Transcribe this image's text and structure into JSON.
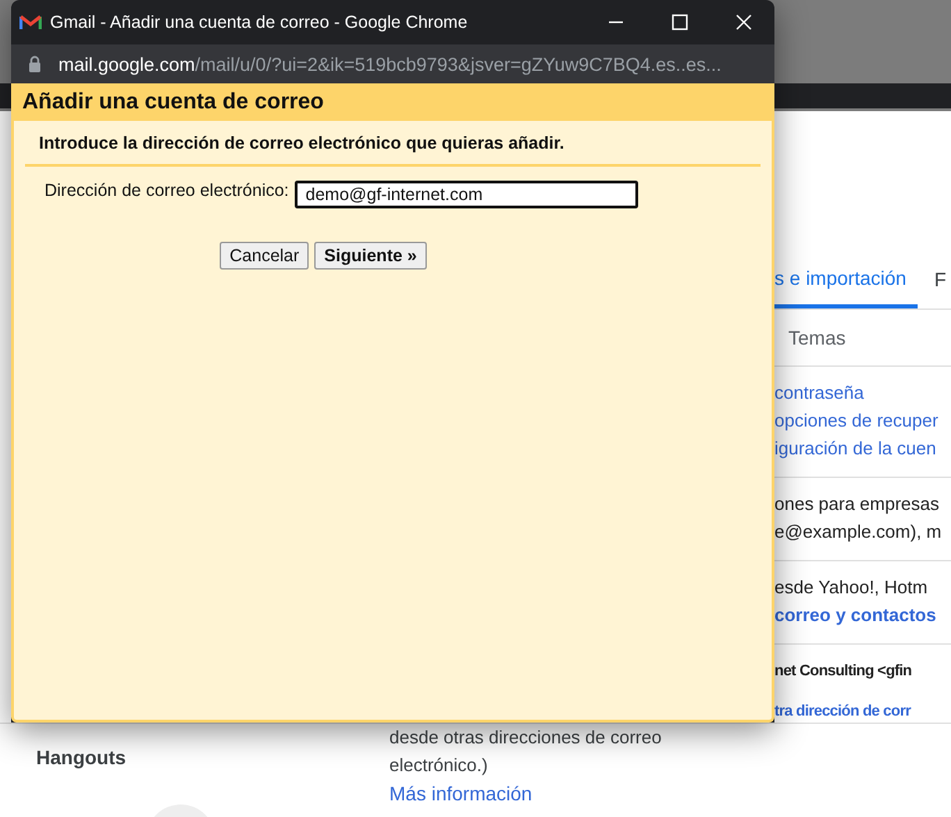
{
  "window": {
    "title": "Gmail - Añadir una cuenta de correo - Google Chrome",
    "url_host": "mail.google.com",
    "url_path": "/mail/u/0/?ui=2&ik=519bcb9793&jsver=gZYuw9C7BQ4.es..es..."
  },
  "dialog": {
    "title": "Añadir una cuenta de correo",
    "instruction": "Introduce la dirección de correo electrónico que quieras añadir.",
    "field_label": "Dirección de correo electrónico:",
    "field_value": "demo@gf-internet.com",
    "buttons": [
      {
        "label": "Cancelar",
        "primary": false
      },
      {
        "label": "Siguiente »",
        "primary": true
      }
    ]
  },
  "background": {
    "tabs": [
      {
        "label": "s e importación",
        "selected": true
      },
      {
        "label": "F",
        "selected": false
      }
    ],
    "subtab": "Temas",
    "sections": [
      {
        "lines": [
          {
            "text": "contraseña",
            "kind": "link"
          },
          {
            "text": "opciones de recuper",
            "kind": "link"
          },
          {
            "text": "iguración de la cuen",
            "kind": "link"
          }
        ]
      },
      {
        "lines": [
          {
            "text": "ones para empresas",
            "kind": "text"
          },
          {
            "text": "e@example.com), m",
            "kind": "text"
          }
        ]
      },
      {
        "lines": [
          {
            "text": "esde Yahoo!, Hotm",
            "kind": "text"
          },
          {
            "text": "correo y contactos",
            "kind": "bold-link"
          }
        ]
      },
      {
        "lines": [
          {
            "text": "net Consulting <gfin",
            "kind": "bold"
          },
          {
            "text": "tra dirección de corr",
            "kind": "bold-link"
          }
        ]
      }
    ],
    "sidebar_item": "Hangouts",
    "description": [
      "desde otras direcciones de correo",
      "electrónico.)"
    ],
    "more_link": "Más información"
  }
}
